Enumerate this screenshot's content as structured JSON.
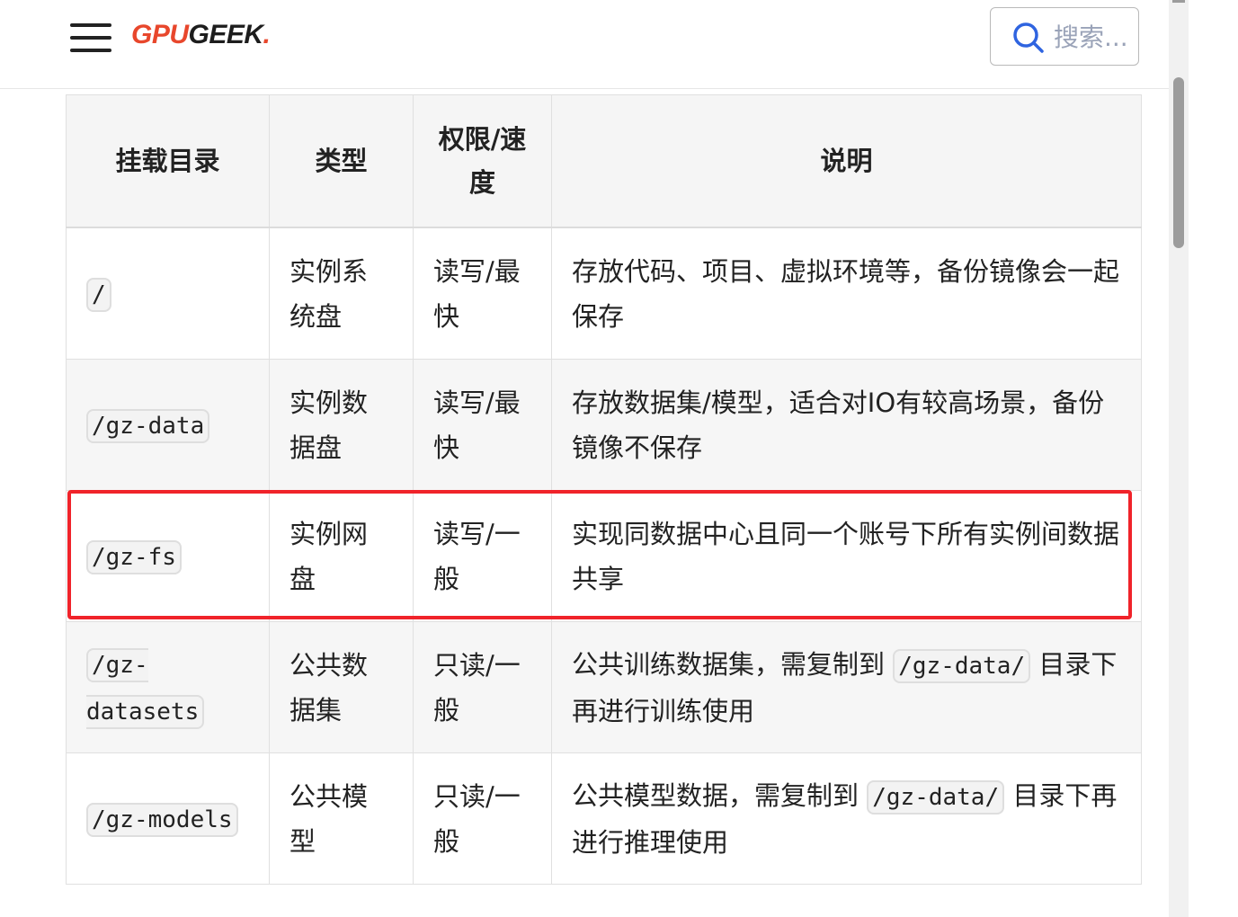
{
  "header": {
    "logo_gpu": "GPU",
    "logo_geek": "GEEK",
    "logo_dot": ".",
    "search_placeholder": "搜索..."
  },
  "table": {
    "headers": [
      "挂载目录",
      "类型",
      "权限/速度",
      "说明"
    ],
    "rows": [
      {
        "path": "/",
        "type": "实例系统盘",
        "perm": "读写/最快",
        "desc": "存放代码、项目、虚拟环境等，备份镜像会一起保存"
      },
      {
        "path": "/gz-data",
        "type": "实例数据盘",
        "perm": "读写/最快",
        "desc": "存放数据集/模型，适合对IO有较高场景，备份镜像不保存"
      },
      {
        "path": "/gz-fs",
        "type": "实例网盘",
        "perm": "读写/一般",
        "desc": "实现同数据中心且同一个账号下所有实例间数据共享"
      },
      {
        "path": "/gz-datasets",
        "type": "公共数据集",
        "perm": "只读/一般",
        "desc_before": "公共训练数据集，需复制到",
        "desc_code": "/gz-data/",
        "desc_after": "目录下再进行训练使用"
      },
      {
        "path": "/gz-models",
        "type": "公共模型",
        "perm": "只读/一般",
        "desc_before": "公共模型数据，需复制到",
        "desc_code": "/gz-data/",
        "desc_after": "目录下再进行推理使用"
      }
    ]
  },
  "colors": {
    "brand_red": "#e8472c",
    "highlight_red": "#f0232a"
  }
}
